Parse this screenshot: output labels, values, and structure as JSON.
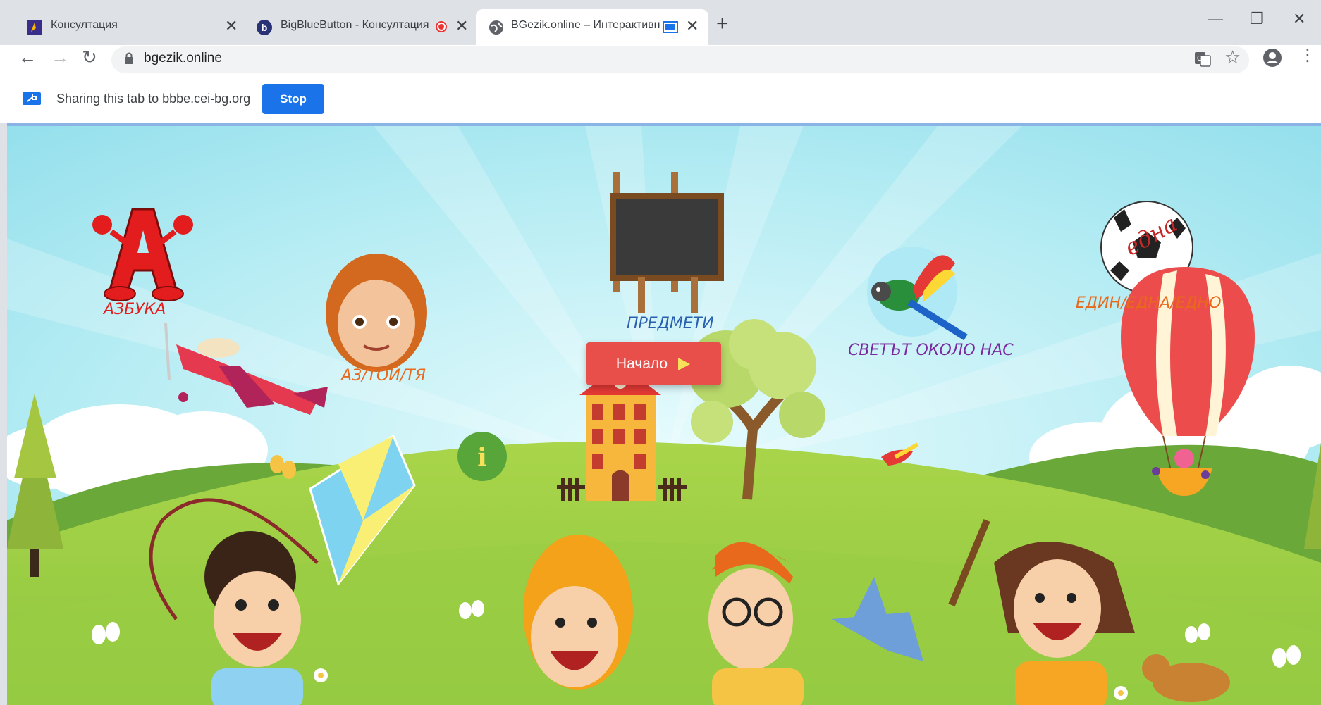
{
  "tabs": [
    {
      "title": "Консултация",
      "icon": "moodle-favicon"
    },
    {
      "title": "BigBlueButton - Консултация",
      "icon": "bigbluebutton-favicon",
      "recording": true
    },
    {
      "title": "BGezik.online – Интерактивна",
      "icon": "globe-favicon",
      "sharing": true
    }
  ],
  "address": {
    "url": "bgezik.online"
  },
  "share": {
    "text": "Sharing this tab to bbbe.cei-bg.org",
    "stop_label": "Stop"
  },
  "page": {
    "labels": {
      "azbuka": "АЗБУКА",
      "az": "АЗ/ТОЙ/ТЯ",
      "predmeti": "ПРЕДМЕТИ",
      "svetat": "СВЕТЪТ ОКОЛО НАС",
      "edin": "ЕДИН/ЕДНА/ЕДНО",
      "edna": "една"
    },
    "start_label": "Начало",
    "info_label": "i"
  },
  "colors": {
    "accent": "#1a73e8",
    "start": "#e84f4a",
    "azbuka": "#e31d1d",
    "az": "#e8691c",
    "predmeti": "#2a5fb0",
    "svetat": "#7a2aa0",
    "edin": "#e8691c"
  }
}
